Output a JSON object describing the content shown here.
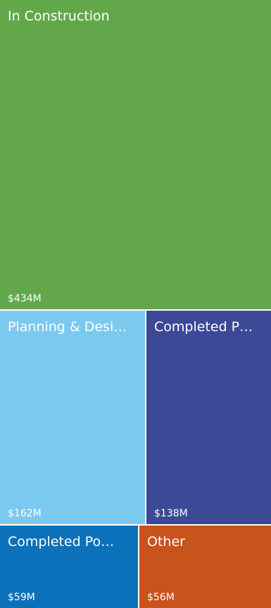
{
  "chart_data": {
    "type": "treemap",
    "items": [
      {
        "label": "In Construction",
        "value": 434,
        "value_label": "$434M",
        "color": "#62A84A"
      },
      {
        "label": "Planning & Desi…",
        "value": 162,
        "value_label": "$162M",
        "color": "#7CC9F0"
      },
      {
        "label": "Completed P…",
        "value": 138,
        "value_label": "$138M",
        "color": "#3C4996"
      },
      {
        "label": "Completed Po…",
        "value": 59,
        "value_label": "$59M",
        "color": "#0B71BA"
      },
      {
        "label": "Other",
        "value": 56,
        "value_label": "$56M",
        "color": "#C8531C"
      }
    ]
  }
}
